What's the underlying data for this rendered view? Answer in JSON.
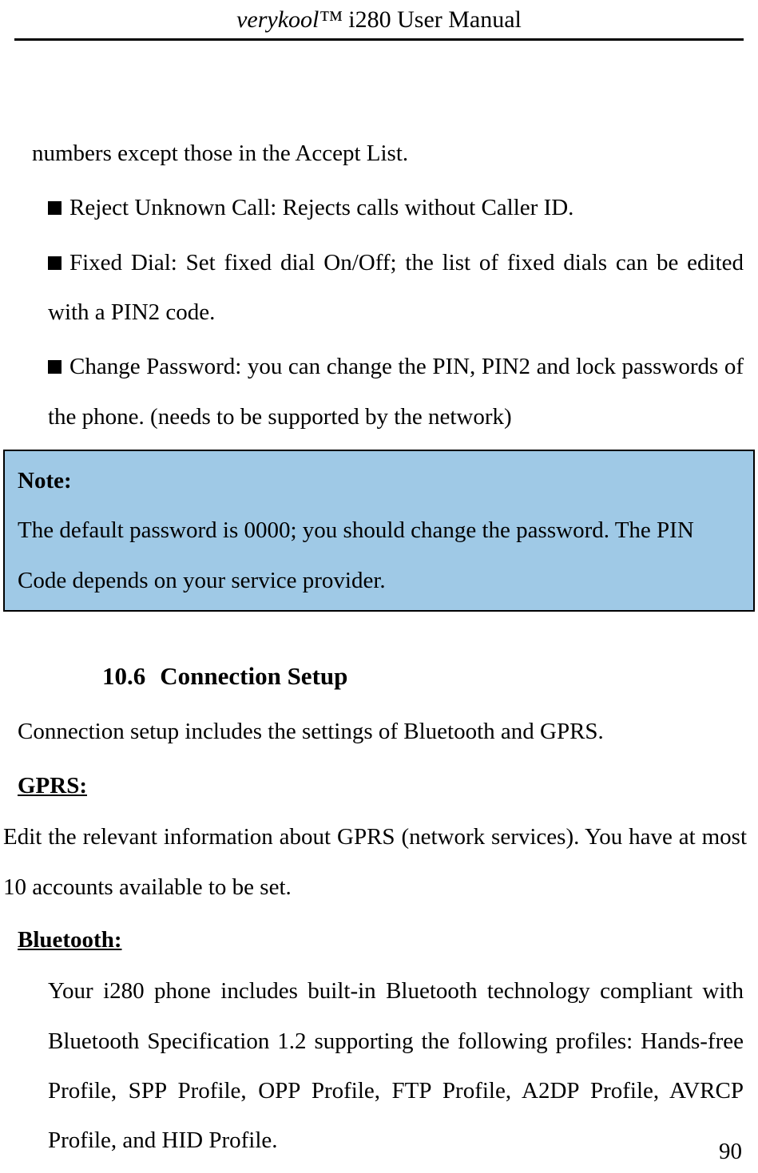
{
  "header": {
    "brand_italic": "verykool™",
    "title_rest": " i280 User Manual"
  },
  "intro_line": "numbers except those in the Accept List.",
  "bullets_top": [
    "Reject Unknown Call: Rejects calls without Caller ID.",
    "Fixed Dial: Set fixed dial On/Off; the list of fixed dials can be edited with a PIN2 code.",
    "Change Password: you can change the PIN, PIN2 and lock passwords of the phone. (needs to be supported by the network)"
  ],
  "note": {
    "title": "Note:",
    "body": "The default password is 0000; you should change the password. The PIN Code depends on your service provider."
  },
  "section": {
    "number": "10.6",
    "title": "Connection Setup",
    "intro": "Connection setup includes the settings of Bluetooth and GPRS."
  },
  "gprs": {
    "heading": "GPRS:",
    "body": "Edit the relevant information about GPRS (network services). You have at most 10 accounts available to be set."
  },
  "bluetooth": {
    "heading": "Bluetooth:",
    "bullet": "Your i280 phone includes built-in Bluetooth technology compliant with Bluetooth Specification 1.2 supporting the following profiles: Hands-free Profile, SPP Profile, OPP Profile, FTP Profile, A2DP Profile, AVRCP Profile, and HID Profile."
  },
  "page_number": "90"
}
